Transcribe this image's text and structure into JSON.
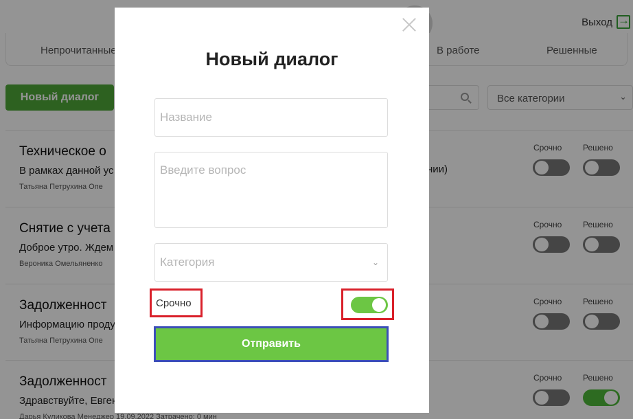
{
  "header": {
    "logout_label": "Выход"
  },
  "tabs": [
    "Непрочитанные",
    "В работе",
    "Решенные"
  ],
  "toolbar": {
    "new_dialog_label": "Новый диалог",
    "category_filter_value": "Все категории"
  },
  "dialogs": [
    {
      "title": "Техническое о",
      "text": "В рамках данной ус",
      "meta": "Татьяна Петрухина    Опе",
      "urgent_label": "Срочно",
      "resolved_label": "Решено",
      "urgent": false,
      "resolved": false
    },
    {
      "title": "Снятие с учета",
      "text": "Доброе утро. Ждем",
      "meta": "Вероника Омельяненко",
      "urgent_label": "Срочно",
      "resolved_label": "Решено",
      "urgent": false,
      "resolved": false
    },
    {
      "title": "Задолженност",
      "text": "Информацию проду",
      "meta": "Татьяна Петрухина    Опе",
      "urgent_label": "Срочно",
      "resolved_label": "Решено",
      "urgent": false,
      "resolved": false
    },
    {
      "title": "Задолженност",
      "text": "Здравствуйте, Евген",
      "meta": "Дарья Куликова    Менеджер    19.09.2022    Затрачено: 0 мин",
      "urgent_label": "Срочно",
      "resolved_label": "Решено",
      "urgent": false,
      "resolved": true
    }
  ],
  "background_fragment": "нии)",
  "modal": {
    "title": "Новый диалог",
    "name_placeholder": "Название",
    "question_placeholder": "Введите вопрос",
    "category_placeholder": "Категория",
    "urgent_label": "Срочно",
    "urgent_on": true,
    "submit_label": "Отправить"
  },
  "colors": {
    "accent_green": "#6cc644",
    "button_green": "#4fa838",
    "highlight_red": "#d9202a",
    "highlight_blue": "#3b4fb8"
  }
}
